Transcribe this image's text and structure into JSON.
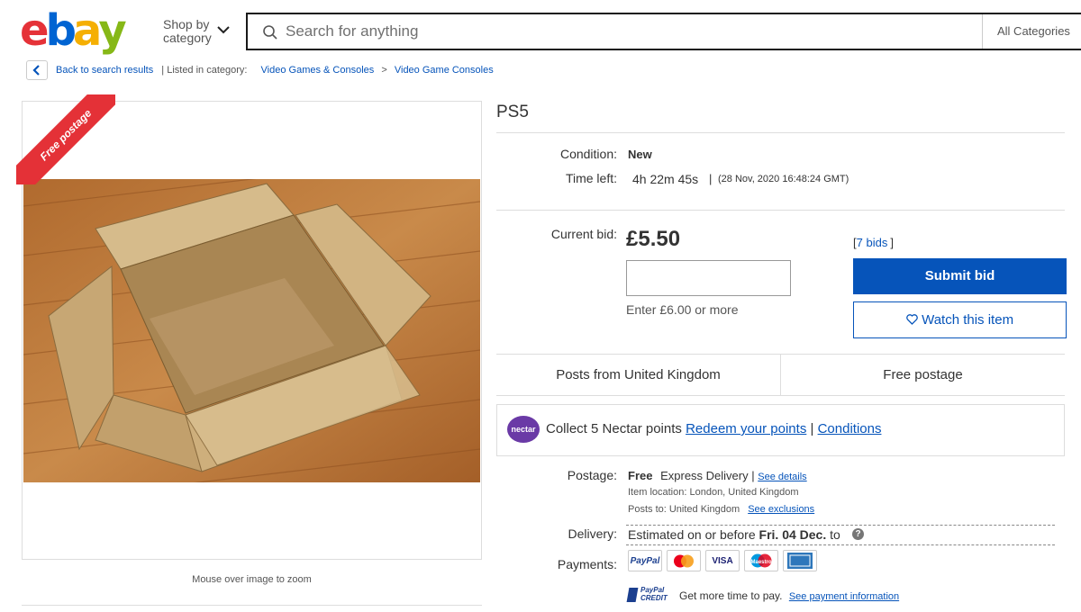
{
  "header": {
    "logo_letters": [
      "e",
      "b",
      "a",
      "y"
    ],
    "logo_colors": [
      "#e53238",
      "#0064d2",
      "#f5af02",
      "#86b817"
    ],
    "shop_by_line1": "Shop by",
    "shop_by_line2": "category",
    "search_placeholder": "Search for anything",
    "category_select": "All Categories"
  },
  "breadcrumb": {
    "back_label": "Back to search results",
    "listed_in": "| Listed in category:",
    "cat1": "Video Games & Consoles",
    "separator": ">",
    "cat2": "Video Game Consoles"
  },
  "gallery": {
    "ribbon_text": "Free postage",
    "zoom_hint": "Mouse over image to zoom"
  },
  "listing": {
    "title": "PS5",
    "condition_label": "Condition:",
    "condition_value": "New",
    "time_left_label": "Time left:",
    "time_left_value": "4h 22m 45s",
    "time_sep": "|",
    "end_time": "(28 Nov, 2020  16:48:24 GMT)",
    "current_bid_label": "Current bid:",
    "current_bid_value": "£5.50",
    "bids_open": "[",
    "bids_count": "7 bids",
    "bids_close": "]",
    "bid_hint": "Enter £6.00 or more",
    "submit_label": "Submit bid",
    "watch_label": "Watch this item",
    "posts_from": "Posts from United Kingdom",
    "free_postage": "Free postage"
  },
  "nectar": {
    "logo_text": "nectar",
    "text": "Collect 5 Nectar points",
    "redeem": "Redeem your points",
    "sep": "|",
    "conditions": "Conditions"
  },
  "postage": {
    "label": "Postage:",
    "free": "Free",
    "method": "Express Delivery |",
    "see_details": "See details",
    "location": "Item location:  London, United Kingdom",
    "posts_to": "Posts to:  United Kingdom",
    "see_exclusions": "See exclusions"
  },
  "delivery": {
    "label": "Delivery:",
    "text": "Estimated on or before",
    "date": "Fri. 04 Dec.",
    "to": "to"
  },
  "payments": {
    "label": "Payments:",
    "methods": [
      "PayPal",
      "Mastercard",
      "VISA",
      "Maestro",
      "American Express"
    ],
    "credit_logo_line1": "PayPal",
    "credit_logo_line2": "CREDIT",
    "credit_text": "Get more time to pay.",
    "see_payment": "See payment information"
  }
}
